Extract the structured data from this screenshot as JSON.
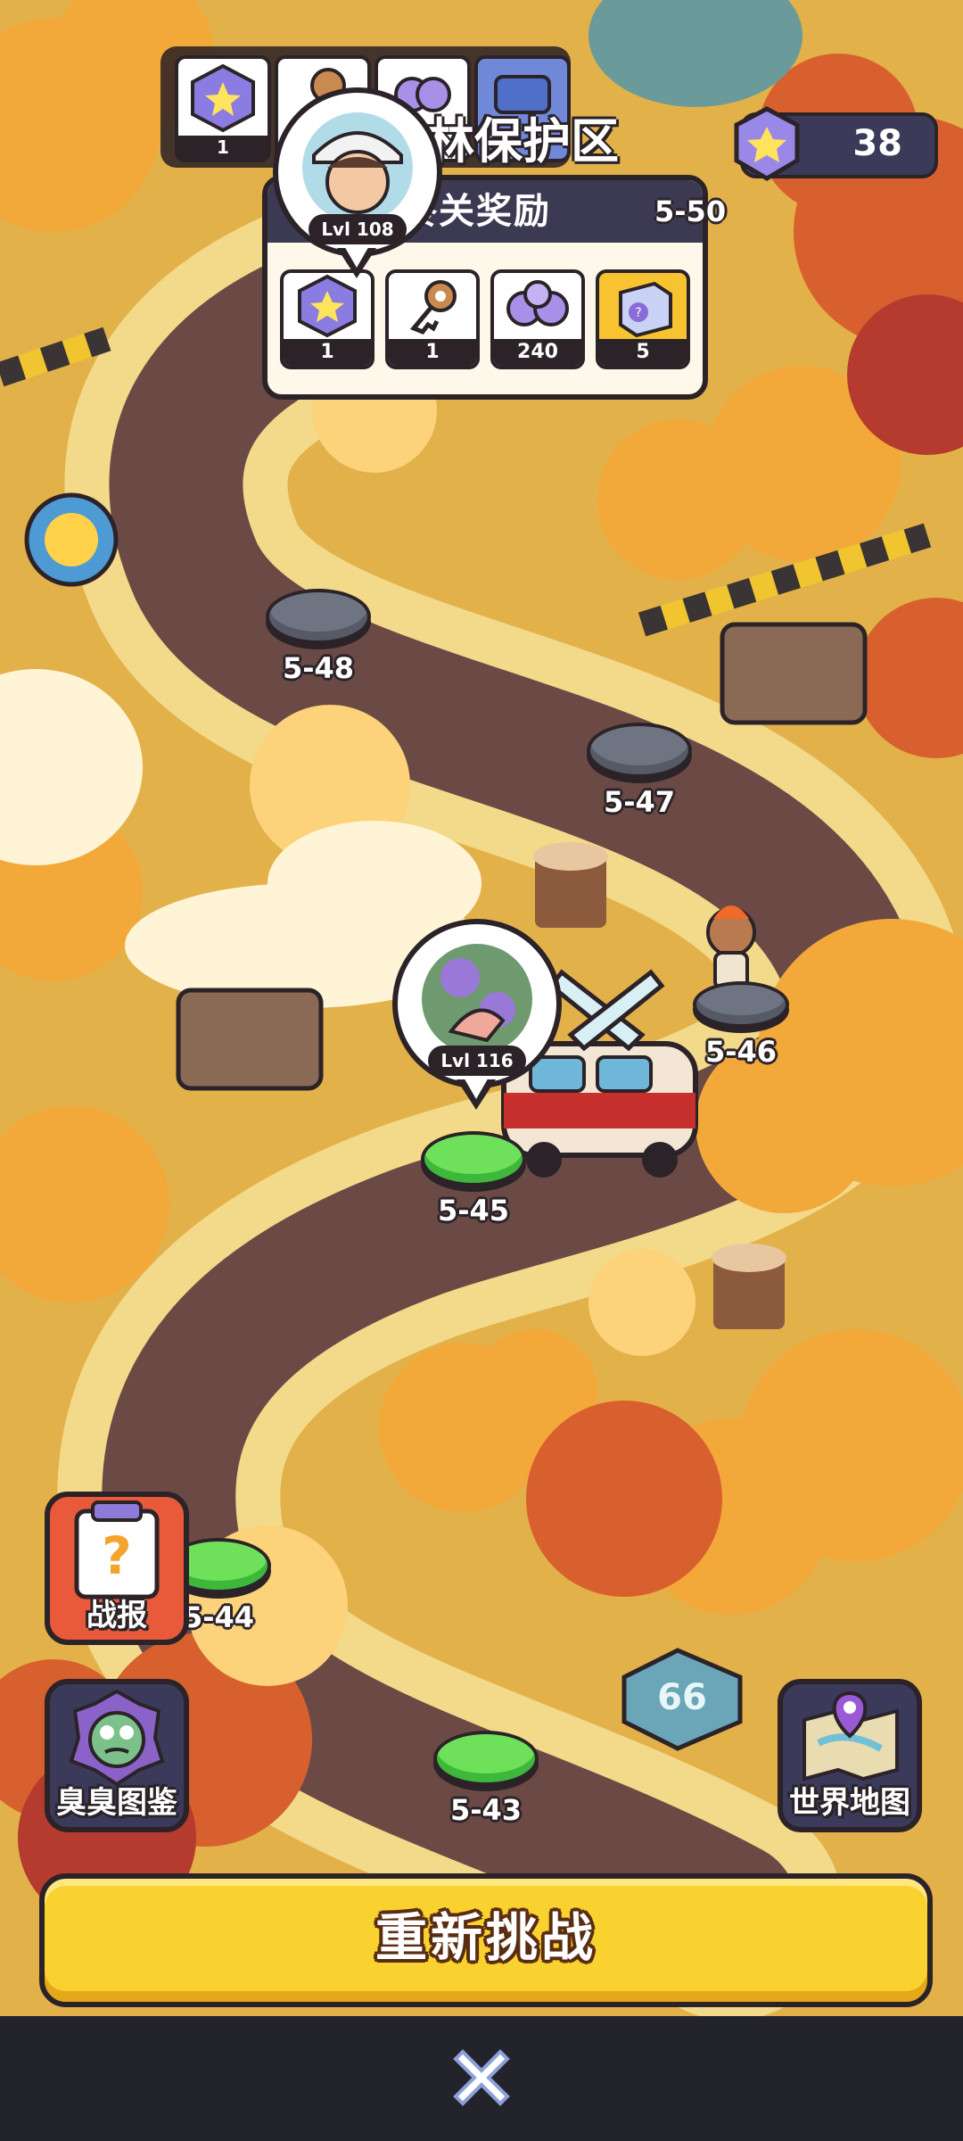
{
  "zone": {
    "title": "林保护区"
  },
  "top_items": [
    {
      "icon": "star-gem-icon",
      "count": "1"
    },
    {
      "icon": "key-icon",
      "count": ""
    },
    {
      "icon": "orbs-icon",
      "count": ""
    },
    {
      "icon": "ticket-icon",
      "count": ""
    }
  ],
  "currency": {
    "icon": "star-gem-icon",
    "amount": "38"
  },
  "reward_panel": {
    "title": "终关奖励",
    "next_stage": "5-50",
    "rewards": [
      {
        "icon": "star-gem-icon",
        "count": "1"
      },
      {
        "icon": "key-icon",
        "count": "1"
      },
      {
        "icon": "orbs-icon",
        "count": "240"
      },
      {
        "icon": "mystery-box-icon",
        "count": "5"
      }
    ]
  },
  "avatars": {
    "rival": {
      "level": "Lvl 108"
    },
    "player": {
      "level": "Lvl 116"
    }
  },
  "stages": [
    {
      "id": "5-48",
      "status": "locked"
    },
    {
      "id": "5-47",
      "status": "locked"
    },
    {
      "id": "5-46",
      "status": "locked"
    },
    {
      "id": "5-45",
      "status": "cleared"
    },
    {
      "id": "5-44",
      "status": "cleared",
      "visible_text": "5-44"
    },
    {
      "id": "5-43",
      "status": "cleared"
    }
  ],
  "side_buttons": {
    "battle_report": "战报",
    "zombie_guide": "臭臭图鉴",
    "world_map": "世界地图"
  },
  "road_sign": "66",
  "primary_action": "重新挑战",
  "colors": {
    "accent_yellow": "#fad22f",
    "stage_cleared": "#6ee05a",
    "stage_locked": "#6f7482",
    "dark_outline": "#2b2328"
  }
}
